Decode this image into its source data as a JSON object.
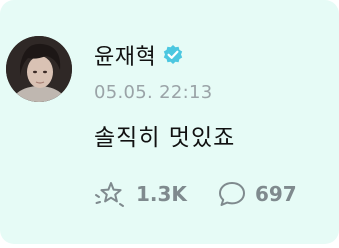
{
  "post": {
    "author": {
      "name": "윤재혁",
      "verified": true,
      "verified_color": "#4cc7e0"
    },
    "timestamp": "05.05. 22:13",
    "text": "솔직히 멋있죠",
    "actions": {
      "like": {
        "icon": "star-sparkle-icon",
        "count": "1.3K"
      },
      "comment": {
        "icon": "speech-bubble-icon",
        "count": "697"
      }
    }
  },
  "colors": {
    "card_background": "#e6fbf6",
    "count_text": "#7f8a8e",
    "timestamp_text": "#9aa3a7"
  }
}
